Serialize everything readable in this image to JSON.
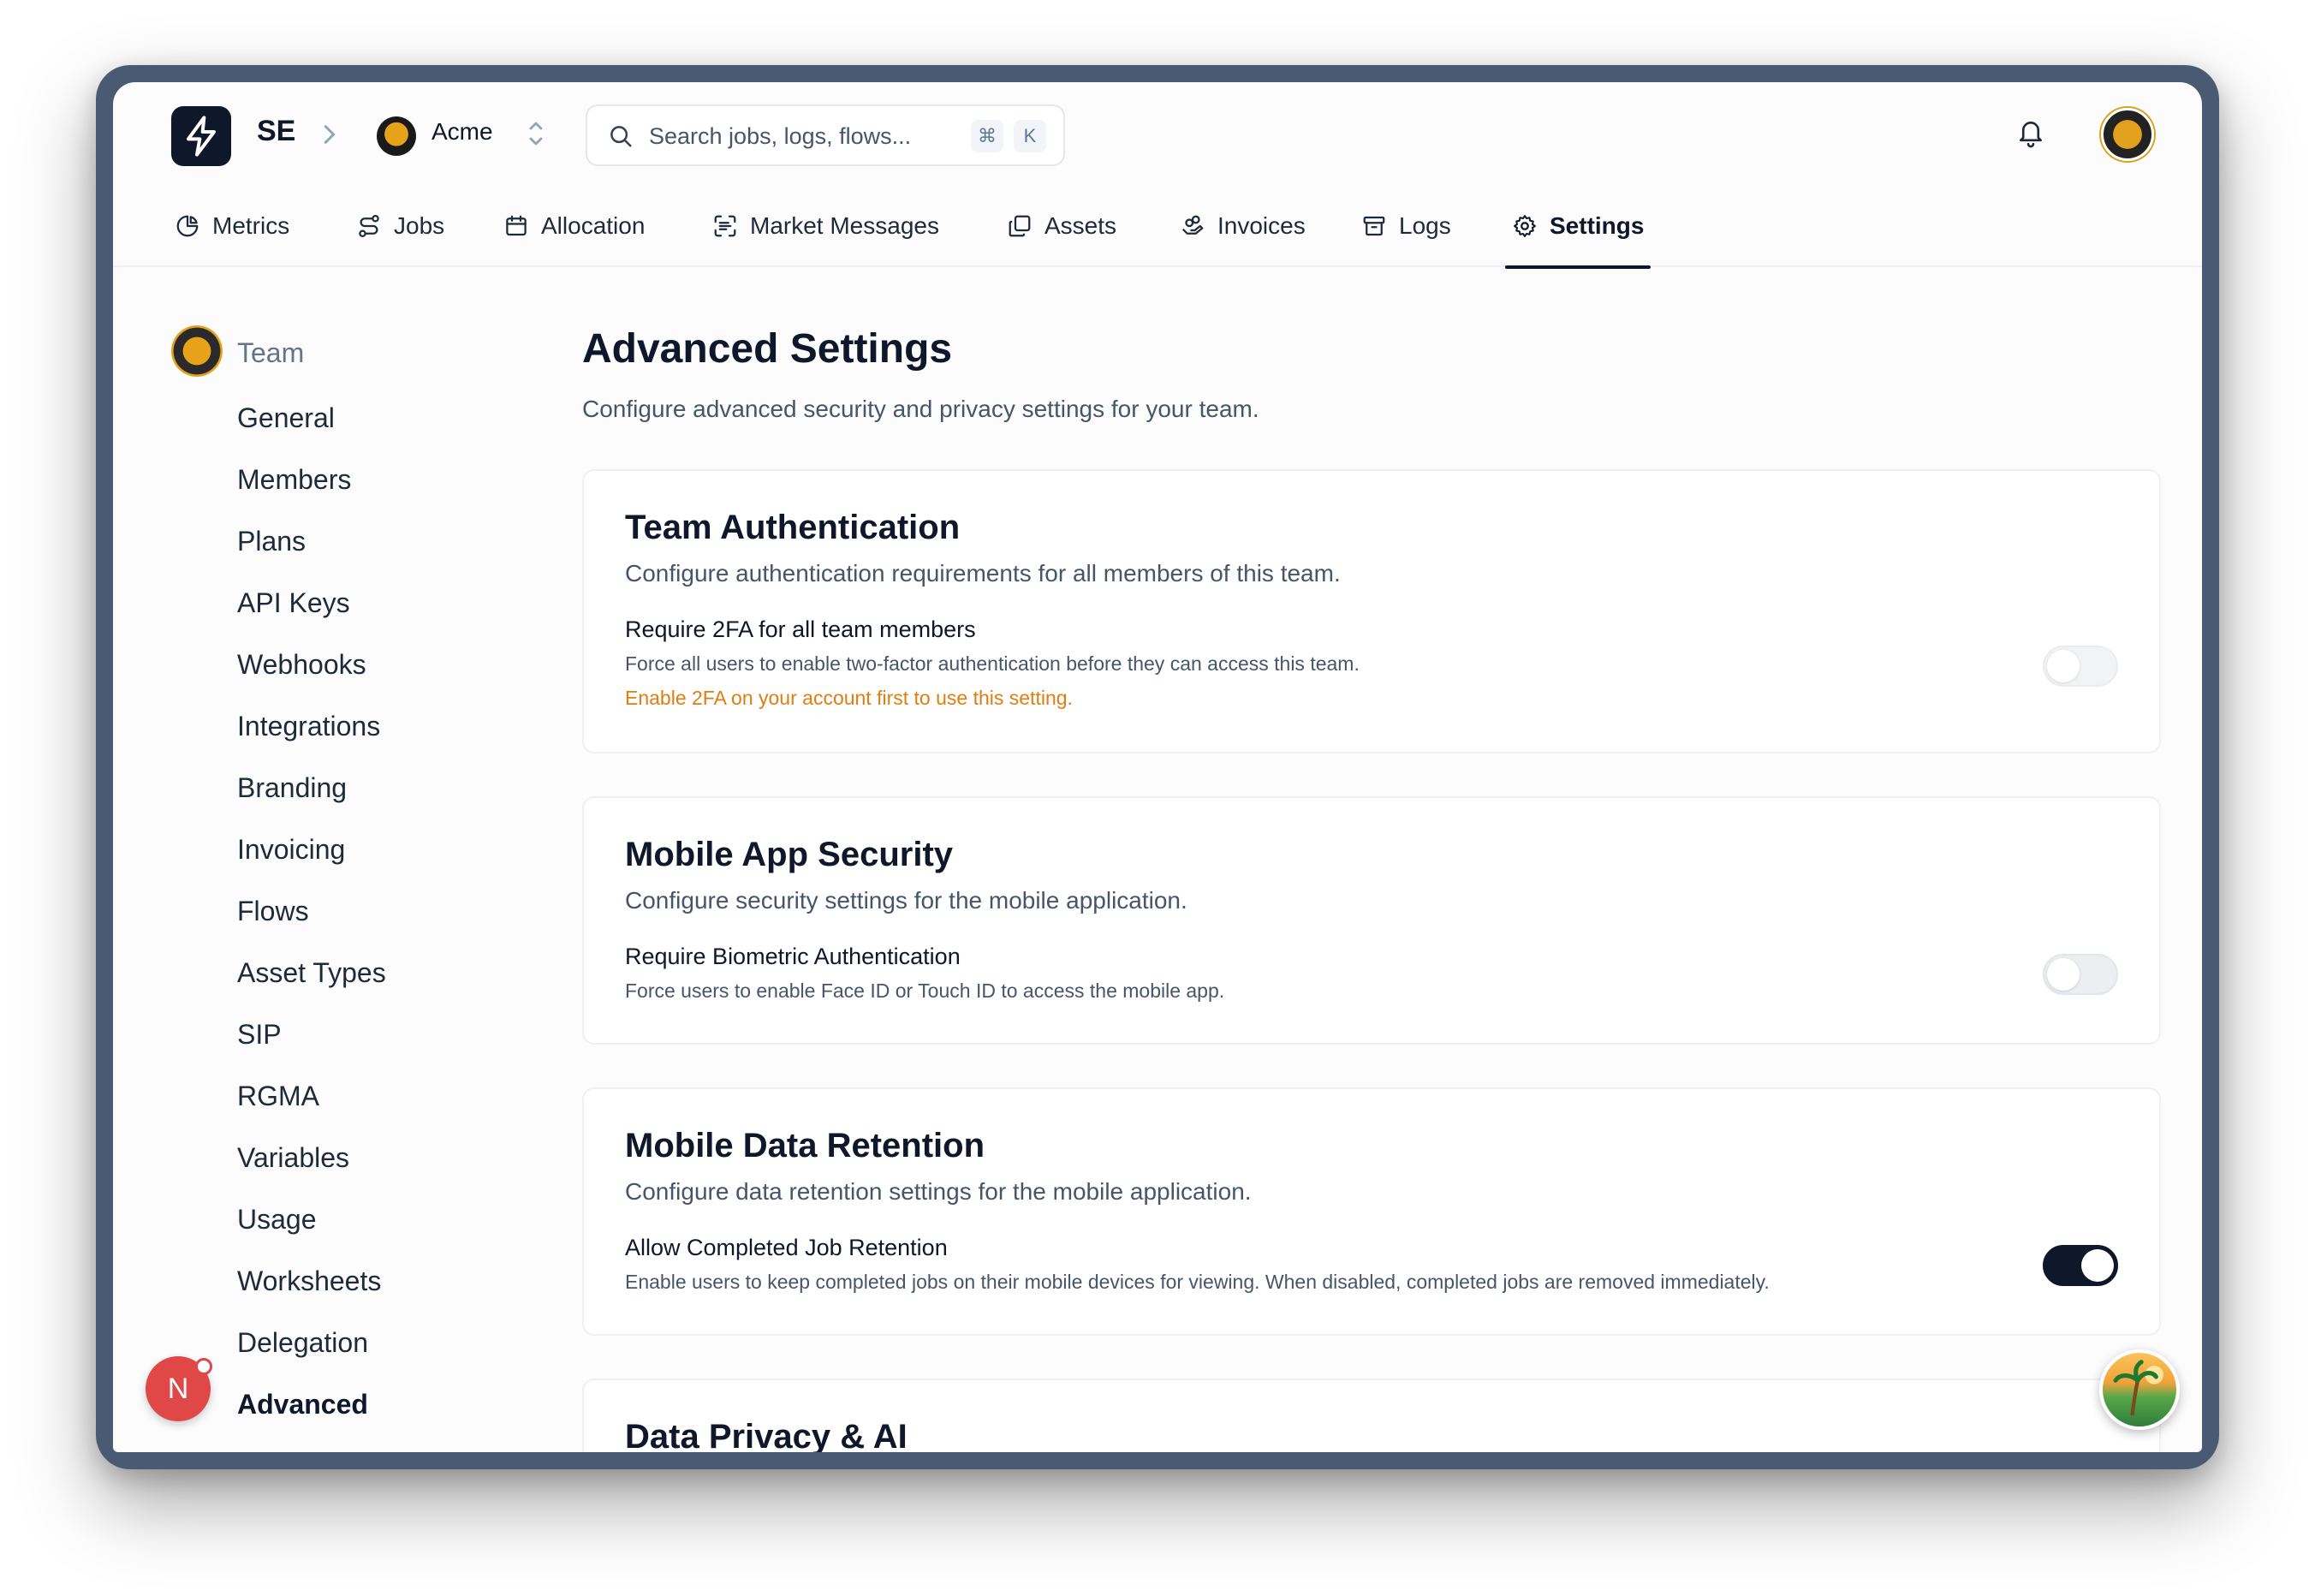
{
  "header": {
    "team_code": "SE",
    "org_name": "Acme",
    "search_placeholder": "Search jobs, logs, flows...",
    "shortcut_keys": [
      "⌘",
      "K"
    ]
  },
  "tabs": [
    {
      "label": "Metrics",
      "icon": "pie-chart-icon"
    },
    {
      "label": "Jobs",
      "icon": "route-icon"
    },
    {
      "label": "Allocation",
      "icon": "calendar-icon"
    },
    {
      "label": "Market Messages",
      "icon": "scan-text-icon"
    },
    {
      "label": "Assets",
      "icon": "copy-icon"
    },
    {
      "label": "Invoices",
      "icon": "hand-coins-icon"
    },
    {
      "label": "Logs",
      "icon": "archive-icon"
    },
    {
      "label": "Settings",
      "icon": "gear-icon",
      "active": true
    }
  ],
  "sidebar": {
    "team_label": "Team",
    "items": [
      "General",
      "Members",
      "Plans",
      "API Keys",
      "Webhooks",
      "Integrations",
      "Branding",
      "Invoicing",
      "Flows",
      "Asset Types",
      "SIP",
      "RGMA",
      "Variables",
      "Usage",
      "Worksheets",
      "Delegation",
      "Advanced"
    ],
    "active_item": "Advanced",
    "user_initial": "N"
  },
  "main": {
    "title": "Advanced Settings",
    "subtitle": "Configure advanced security and privacy settings for your team.",
    "cards": [
      {
        "title": "Team Authentication",
        "subtitle": "Configure authentication requirements for all members of this team.",
        "setting_label": "Require 2FA for all team members",
        "setting_desc": "Force all users to enable two-factor authentication before they can access this team.",
        "warning": "Enable 2FA on your account first to use this setting.",
        "enabled": false
      },
      {
        "title": "Mobile App Security",
        "subtitle": "Configure security settings for the mobile application.",
        "setting_label": "Require Biometric Authentication",
        "setting_desc": "Force users to enable Face ID or Touch ID to access the mobile app.",
        "enabled": false
      },
      {
        "title": "Mobile Data Retention",
        "subtitle": "Configure data retention settings for the mobile application.",
        "setting_label": "Allow Completed Job Retention",
        "setting_desc": "Enable users to keep completed jobs on their mobile devices for viewing. When disabled, completed jobs are removed immediately.",
        "enabled": true
      },
      {
        "title": "Data Privacy & AI"
      }
    ]
  },
  "colors": {
    "accent": "#0f172a",
    "warning": "#e17d10",
    "avatar_red": "#e04848"
  }
}
